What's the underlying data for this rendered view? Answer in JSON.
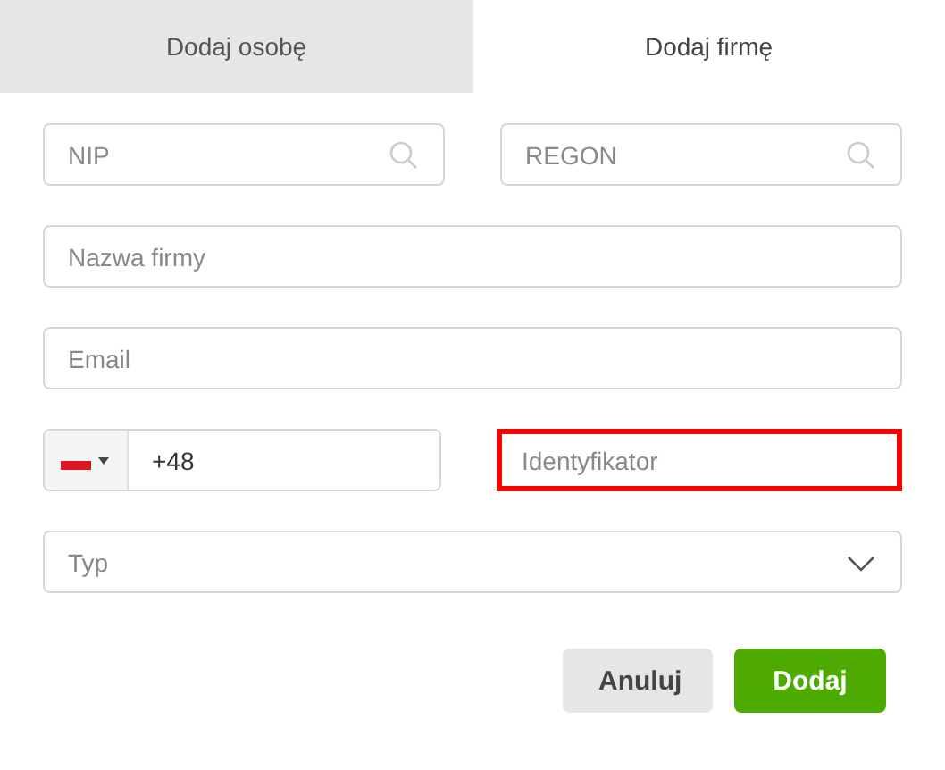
{
  "tabs": [
    {
      "label": "Dodaj osobę",
      "selected": false
    },
    {
      "label": "Dodaj firmę",
      "selected": true
    }
  ],
  "rows": [
    [
      {
        "kind": "search",
        "placeholder": "NIP",
        "invalid": false
      },
      {
        "kind": "search",
        "placeholder": "REGON",
        "invalid": false
      }
    ],
    [
      {
        "kind": "text",
        "placeholder": "Nazwa firmy",
        "invalid": false
      }
    ],
    [
      {
        "kind": "text",
        "placeholder": "Email",
        "invalid": false
      }
    ],
    [
      {
        "kind": "phone",
        "value": "+48",
        "invalid": false
      },
      {
        "kind": "text",
        "placeholder": "Identyfikator",
        "invalid": true
      }
    ],
    [
      {
        "kind": "select",
        "placeholder": "Typ",
        "invalid": false
      }
    ]
  ],
  "buttons": [
    {
      "label": "Anuluj",
      "kind": "secondary"
    },
    {
      "label": "Dodaj",
      "kind": "primary"
    }
  ]
}
